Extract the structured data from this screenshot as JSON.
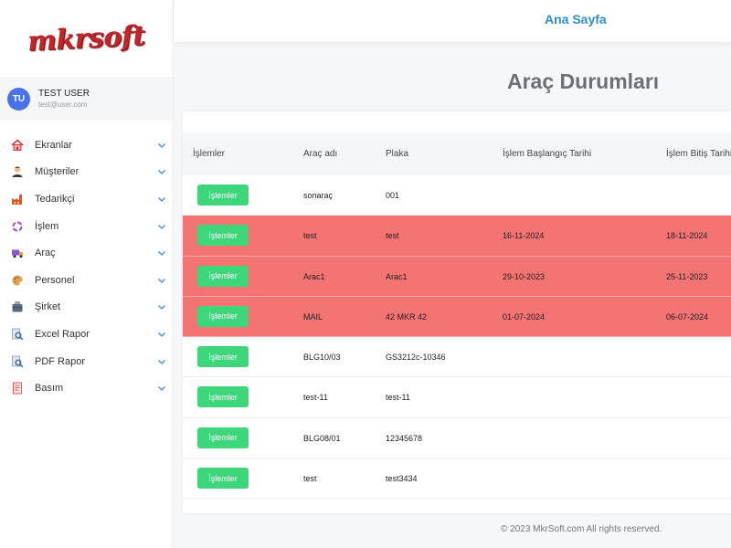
{
  "brand": {
    "logo": "mkrsoft",
    "accent": "#c0272d"
  },
  "user": {
    "initials": "TU",
    "name": "TEST USER",
    "email": "test@user.com"
  },
  "topbar": {
    "home": "Ana Sayfa"
  },
  "sidebar": {
    "items": [
      {
        "label": "Ekranlar",
        "icon": "house-icon"
      },
      {
        "label": "Müşteriler",
        "icon": "person-icon"
      },
      {
        "label": "Tedarikçi",
        "icon": "factory-icon"
      },
      {
        "label": "İşlem",
        "icon": "cycle-icon"
      },
      {
        "label": "Araç",
        "icon": "truck-icon"
      },
      {
        "label": "Personel",
        "icon": "palette-icon"
      },
      {
        "label": "Şirket",
        "icon": "briefcase-icon"
      },
      {
        "label": "Excel Rapor",
        "icon": "magnifier-doc-icon"
      },
      {
        "label": "PDF Rapor",
        "icon": "magnifier-doc-icon"
      },
      {
        "label": "Basım",
        "icon": "printer-doc-icon"
      }
    ]
  },
  "page": {
    "title": "Araç Durumları"
  },
  "table": {
    "headers": [
      "İşlemler",
      "Araç adı",
      "Plaka",
      "İşlem Başlangıç Tarihi",
      "İşlem Bitiş Tarihi"
    ],
    "button_label": "İşlemler",
    "rows": [
      {
        "name": "sonaraç",
        "plate": "001",
        "start": "",
        "end": "",
        "highlight": false
      },
      {
        "name": "test",
        "plate": "test",
        "start": "16-11-2024",
        "end": "18-11-2024",
        "highlight": true
      },
      {
        "name": "Arac1",
        "plate": "Arac1",
        "start": "29-10-2023",
        "end": "25-11-2023",
        "highlight": true
      },
      {
        "name": "MAIL",
        "plate": "42 MKR 42",
        "start": "01-07-2024",
        "end": "06-07-2024",
        "highlight": true
      },
      {
        "name": "BLG10/03",
        "plate": "GS3212c-10346",
        "start": "",
        "end": "",
        "highlight": false
      },
      {
        "name": "test-11",
        "plate": "test-11",
        "start": "",
        "end": "",
        "highlight": false
      },
      {
        "name": "BLG08/01",
        "plate": "12345678",
        "start": "",
        "end": "",
        "highlight": false
      },
      {
        "name": "test",
        "plate": "test3434",
        "start": "",
        "end": "",
        "highlight": false
      }
    ]
  },
  "footer": {
    "text": "© 2023 MkrSoft.com All rights reserved."
  },
  "colors": {
    "highlight_row": "#f47373",
    "button": "#3dd67a",
    "link": "#2e8fd0"
  }
}
